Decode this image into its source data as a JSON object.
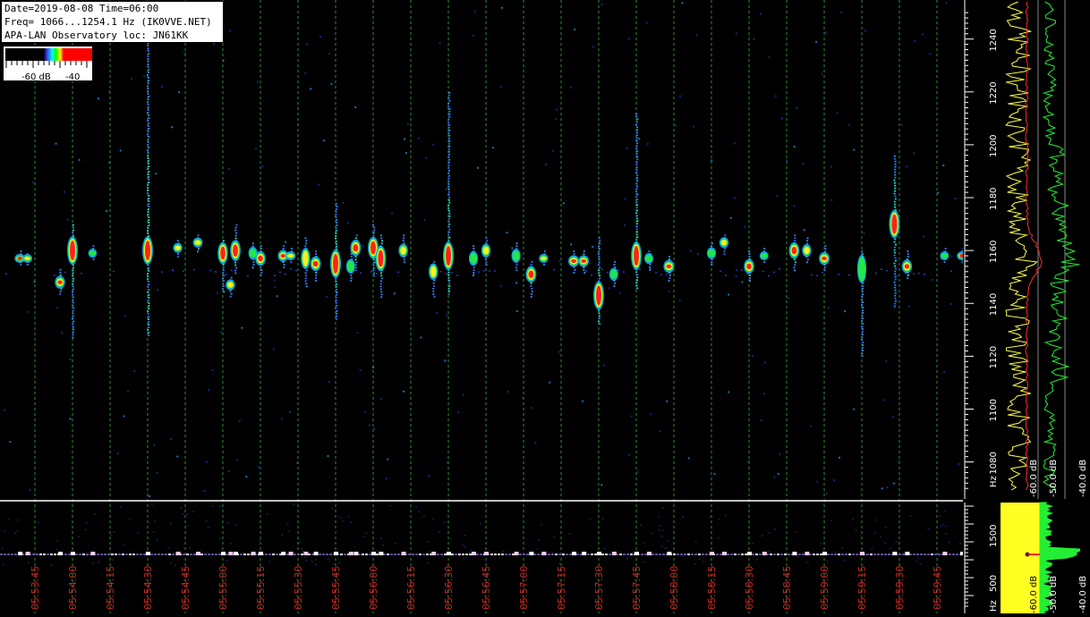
{
  "header": {
    "line1": "Date=2019-08-08 Time=06:00",
    "line2": "Freq= 1066...1254.1 Hz (IK0VVE.NET)",
    "line3": "APA-LAN Observatory loc: JN61KK"
  },
  "scale": {
    "label_low": "-60 dB",
    "label_high": "-40"
  },
  "colors": {
    "background": "#000000",
    "grid": "#2f8f2f",
    "time_label": "#cc2222",
    "freq_label": "#ffffff",
    "trace_yellow": "#ffff44",
    "trace_red": "#ff2a2a",
    "trace_green": "#22ee33"
  },
  "chart_data": [
    {
      "type": "heatmap",
      "title": "",
      "xlabel": "",
      "ylabel": "Hz",
      "ylim": [
        1066,
        1254.1
      ],
      "y_ticks": [
        1080,
        1100,
        1120,
        1140,
        1160,
        1180,
        1200,
        1220,
        1240
      ],
      "y_unit_label": "Hz",
      "time_ticks": [
        "05:53:45",
        "05:54:00",
        "05:54:15",
        "05:54:30",
        "05:54:45",
        "05:55:00",
        "05:55:15",
        "05:55:30",
        "05:55:45",
        "05:56:00",
        "05:56:15",
        "05:56:30",
        "05:56:45",
        "05:57:00",
        "05:57:15",
        "05:57:30",
        "05:57:45",
        "05:58:00",
        "05:58:15",
        "05:58:30",
        "05:58:45",
        "05:59:00",
        "05:59:15",
        "05:59:30",
        "05:59:45"
      ],
      "color_scale_db": [
        -60,
        -40
      ],
      "echoes": [
        {
          "t": "05:53:39",
          "f": 1157,
          "fmin": 1154,
          "fmax": 1160,
          "level": 0.9
        },
        {
          "t": "05:53:42",
          "f": 1157,
          "fmin": 1154,
          "fmax": 1159,
          "level": 0.7
        },
        {
          "t": "05:53:55",
          "f": 1148,
          "fmin": 1143,
          "fmax": 1153,
          "level": 0.85
        },
        {
          "t": "05:54:00",
          "f": 1160,
          "fmin": 1127,
          "fmax": 1170,
          "level": 1.0
        },
        {
          "t": "05:54:08",
          "f": 1159,
          "fmin": 1156,
          "fmax": 1162,
          "level": 0.4
        },
        {
          "t": "05:54:30",
          "f": 1160,
          "fmin": 1128,
          "fmax": 1250,
          "level": 1.0
        },
        {
          "t": "05:54:42",
          "f": 1161,
          "fmin": 1157,
          "fmax": 1164,
          "level": 0.6
        },
        {
          "t": "05:54:50",
          "f": 1163,
          "fmin": 1159,
          "fmax": 1166,
          "level": 0.7
        },
        {
          "t": "05:55:00",
          "f": 1159,
          "fmin": 1144,
          "fmax": 1164,
          "level": 0.9
        },
        {
          "t": "05:55:03",
          "f": 1147,
          "fmin": 1142,
          "fmax": 1150,
          "level": 0.6
        },
        {
          "t": "05:55:05",
          "f": 1160,
          "fmin": 1151,
          "fmax": 1170,
          "level": 0.95
        },
        {
          "t": "05:55:12",
          "f": 1159,
          "fmin": 1153,
          "fmax": 1163,
          "level": 0.5
        },
        {
          "t": "05:55:15",
          "f": 1157,
          "fmin": 1150,
          "fmax": 1162,
          "level": 0.9
        },
        {
          "t": "05:55:24",
          "f": 1158,
          "fmin": 1153,
          "fmax": 1162,
          "level": 0.85
        },
        {
          "t": "05:55:27",
          "f": 1158,
          "fmin": 1155,
          "fmax": 1161,
          "level": 0.8
        },
        {
          "t": "05:55:33",
          "f": 1157,
          "fmin": 1146,
          "fmax": 1165,
          "level": 0.6
        },
        {
          "t": "05:55:37",
          "f": 1155,
          "fmin": 1148,
          "fmax": 1160,
          "level": 0.95
        },
        {
          "t": "05:55:45",
          "f": 1155,
          "fmin": 1134,
          "fmax": 1178,
          "level": 1.0
        },
        {
          "t": "05:55:51",
          "f": 1154,
          "fmin": 1148,
          "fmax": 1160,
          "level": 0.5
        },
        {
          "t": "05:55:53",
          "f": 1161,
          "fmin": 1152,
          "fmax": 1166,
          "level": 0.95
        },
        {
          "t": "05:56:00",
          "f": 1161,
          "fmin": 1150,
          "fmax": 1170,
          "level": 1.0
        },
        {
          "t": "05:56:03",
          "f": 1157,
          "fmin": 1142,
          "fmax": 1166,
          "level": 1.0
        },
        {
          "t": "05:56:12",
          "f": 1160,
          "fmin": 1155,
          "fmax": 1166,
          "level": 0.6
        },
        {
          "t": "05:56:24",
          "f": 1152,
          "fmin": 1142,
          "fmax": 1156,
          "level": 0.6
        },
        {
          "t": "05:56:30",
          "f": 1158,
          "fmin": 1143,
          "fmax": 1220,
          "level": 1.0
        },
        {
          "t": "05:56:40",
          "f": 1157,
          "fmin": 1150,
          "fmax": 1162,
          "level": 0.55
        },
        {
          "t": "05:56:45",
          "f": 1160,
          "fmin": 1154,
          "fmax": 1165,
          "level": 0.6
        },
        {
          "t": "05:56:57",
          "f": 1158,
          "fmin": 1152,
          "fmax": 1163,
          "level": 0.55
        },
        {
          "t": "05:57:03",
          "f": 1151,
          "fmin": 1142,
          "fmax": 1156,
          "level": 0.95
        },
        {
          "t": "05:57:08",
          "f": 1157,
          "fmin": 1154,
          "fmax": 1160,
          "level": 0.6
        },
        {
          "t": "05:57:20",
          "f": 1156,
          "fmin": 1151,
          "fmax": 1160,
          "level": 1.0
        },
        {
          "t": "05:57:24",
          "f": 1156,
          "fmin": 1151,
          "fmax": 1160,
          "level": 0.95
        },
        {
          "t": "05:57:30",
          "f": 1143,
          "fmin": 1132,
          "fmax": 1165,
          "level": 1.0
        },
        {
          "t": "05:57:36",
          "f": 1151,
          "fmin": 1146,
          "fmax": 1156,
          "level": 0.5
        },
        {
          "t": "05:57:45",
          "f": 1158,
          "fmin": 1146,
          "fmax": 1212,
          "level": 0.95
        },
        {
          "t": "05:57:50",
          "f": 1157,
          "fmin": 1152,
          "fmax": 1160,
          "level": 0.5
        },
        {
          "t": "05:57:58",
          "f": 1154,
          "fmin": 1148,
          "fmax": 1158,
          "level": 1.0
        },
        {
          "t": "05:58:15",
          "f": 1159,
          "fmin": 1154,
          "fmax": 1163,
          "level": 0.55
        },
        {
          "t": "05:58:20",
          "f": 1163,
          "fmin": 1158,
          "fmax": 1166,
          "level": 0.6
        },
        {
          "t": "05:58:30",
          "f": 1154,
          "fmin": 1148,
          "fmax": 1160,
          "level": 0.9
        },
        {
          "t": "05:58:36",
          "f": 1158,
          "fmin": 1155,
          "fmax": 1161,
          "level": 0.5
        },
        {
          "t": "05:58:48",
          "f": 1160,
          "fmin": 1152,
          "fmax": 1166,
          "level": 0.9
        },
        {
          "t": "05:58:53",
          "f": 1160,
          "fmin": 1155,
          "fmax": 1165,
          "level": 0.6
        },
        {
          "t": "05:59:00",
          "f": 1157,
          "fmin": 1152,
          "fmax": 1162,
          "level": 0.95
        },
        {
          "t": "05:59:15",
          "f": 1153,
          "fmin": 1120,
          "fmax": 1160,
          "level": 0.55
        },
        {
          "t": "05:59:28",
          "f": 1170,
          "fmin": 1139,
          "fmax": 1196,
          "level": 1.0
        },
        {
          "t": "05:59:33",
          "f": 1154,
          "fmin": 1149,
          "fmax": 1160,
          "level": 0.85
        },
        {
          "t": "05:59:48",
          "f": 1158,
          "fmin": 1155,
          "fmax": 1161,
          "level": 0.5
        },
        {
          "t": "05:59:55",
          "f": 1158,
          "fmin": 1155,
          "fmax": 1161,
          "level": 0.85
        }
      ]
    },
    {
      "type": "line",
      "title": "",
      "xlabel": "dB",
      "ylabel": "",
      "x_ticks": [
        "-60.0 dB",
        "-50.0 dB",
        "-40.0 dB"
      ],
      "series": [
        {
          "name": "",
          "color": "#ffff44"
        },
        {
          "name": "",
          "color": "#ff2a2a"
        },
        {
          "name": "",
          "color": "#22ee33"
        }
      ]
    },
    {
      "type": "heatmap",
      "title": "",
      "xlabel": "",
      "ylabel": "Hz",
      "y_ticks": [
        500,
        1500
      ],
      "y_unit_label": "Hz",
      "note_band_hz": 1160
    },
    {
      "type": "line",
      "title": "",
      "xlabel": "dB",
      "ylabel": "",
      "x_ticks": [
        "-60.0 dB",
        "-50.0 dB",
        "-40.0 dB"
      ]
    }
  ]
}
